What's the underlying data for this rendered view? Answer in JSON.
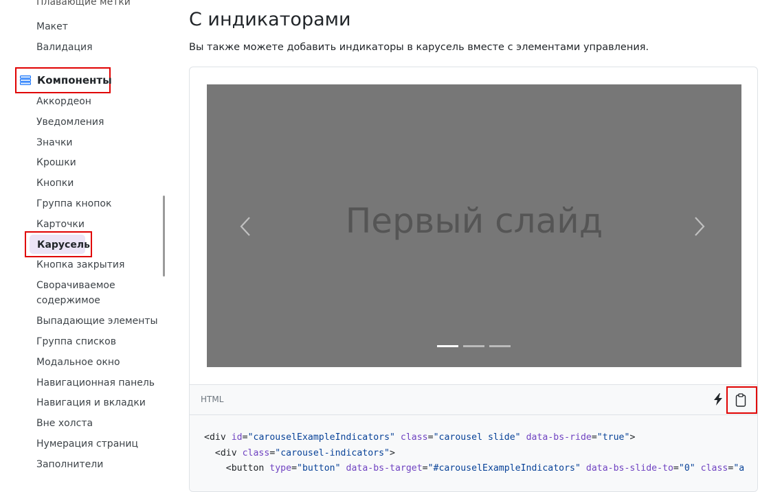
{
  "sidebar": {
    "cut_item": "Плавающие метки",
    "items_above": [
      "Макет",
      "Валидация"
    ],
    "section": {
      "label": "Компоненты",
      "icon": "layers-icon"
    },
    "items": [
      "Аккордеон",
      "Уведомления",
      "Значки",
      "Крошки",
      "Кнопки",
      "Группа кнопок",
      "Карточки",
      "Карусель",
      "Кнопка закрытия",
      "Сворачиваемое",
      "содержимое",
      "Выпадающие элементы",
      "Группа списков",
      "Модальное окно",
      "Навигационная панель",
      "Навигация и вкладки",
      "Вне холста",
      "Нумерация страниц",
      "Заполнители"
    ],
    "active_item": "Карусель"
  },
  "main": {
    "title": "С индикаторами",
    "description": "Вы также можете добавить индикаторы в карусель вместе с элементами управления."
  },
  "carousel": {
    "slide_text": "Первый слайд",
    "prev_icon": "chevron-left-icon",
    "next_icon": "chevron-right-icon",
    "indicators_count": 3,
    "active_indicator": 0
  },
  "code": {
    "language": "HTML",
    "action_icons": [
      "lightning-icon",
      "clipboard-icon"
    ],
    "line1": {
      "tag": "div",
      "a1": "id",
      "v1": "\"carouselExampleIndicators\"",
      "a2": "class",
      "v2": "\"carousel slide\"",
      "a3": "data-bs-ride",
      "v3": "\"true\""
    },
    "line2": {
      "tag": "div",
      "a1": "class",
      "v1": "\"carousel-indicators\""
    },
    "line3": {
      "tag": "button",
      "a1": "type",
      "v1": "\"button\"",
      "a2": "data-bs-target",
      "v2": "\"#carouselExampleIndicators\"",
      "a3": "data-bs-slide-to",
      "v3": "\"0\"",
      "a4": "class",
      "v4": "\"a"
    }
  },
  "colors": {
    "highlight_border": "#e00000",
    "active_bg": "#ebe4f6",
    "carousel_bg": "#777777",
    "attr_color": "#6f42c1",
    "value_color": "#084298"
  }
}
